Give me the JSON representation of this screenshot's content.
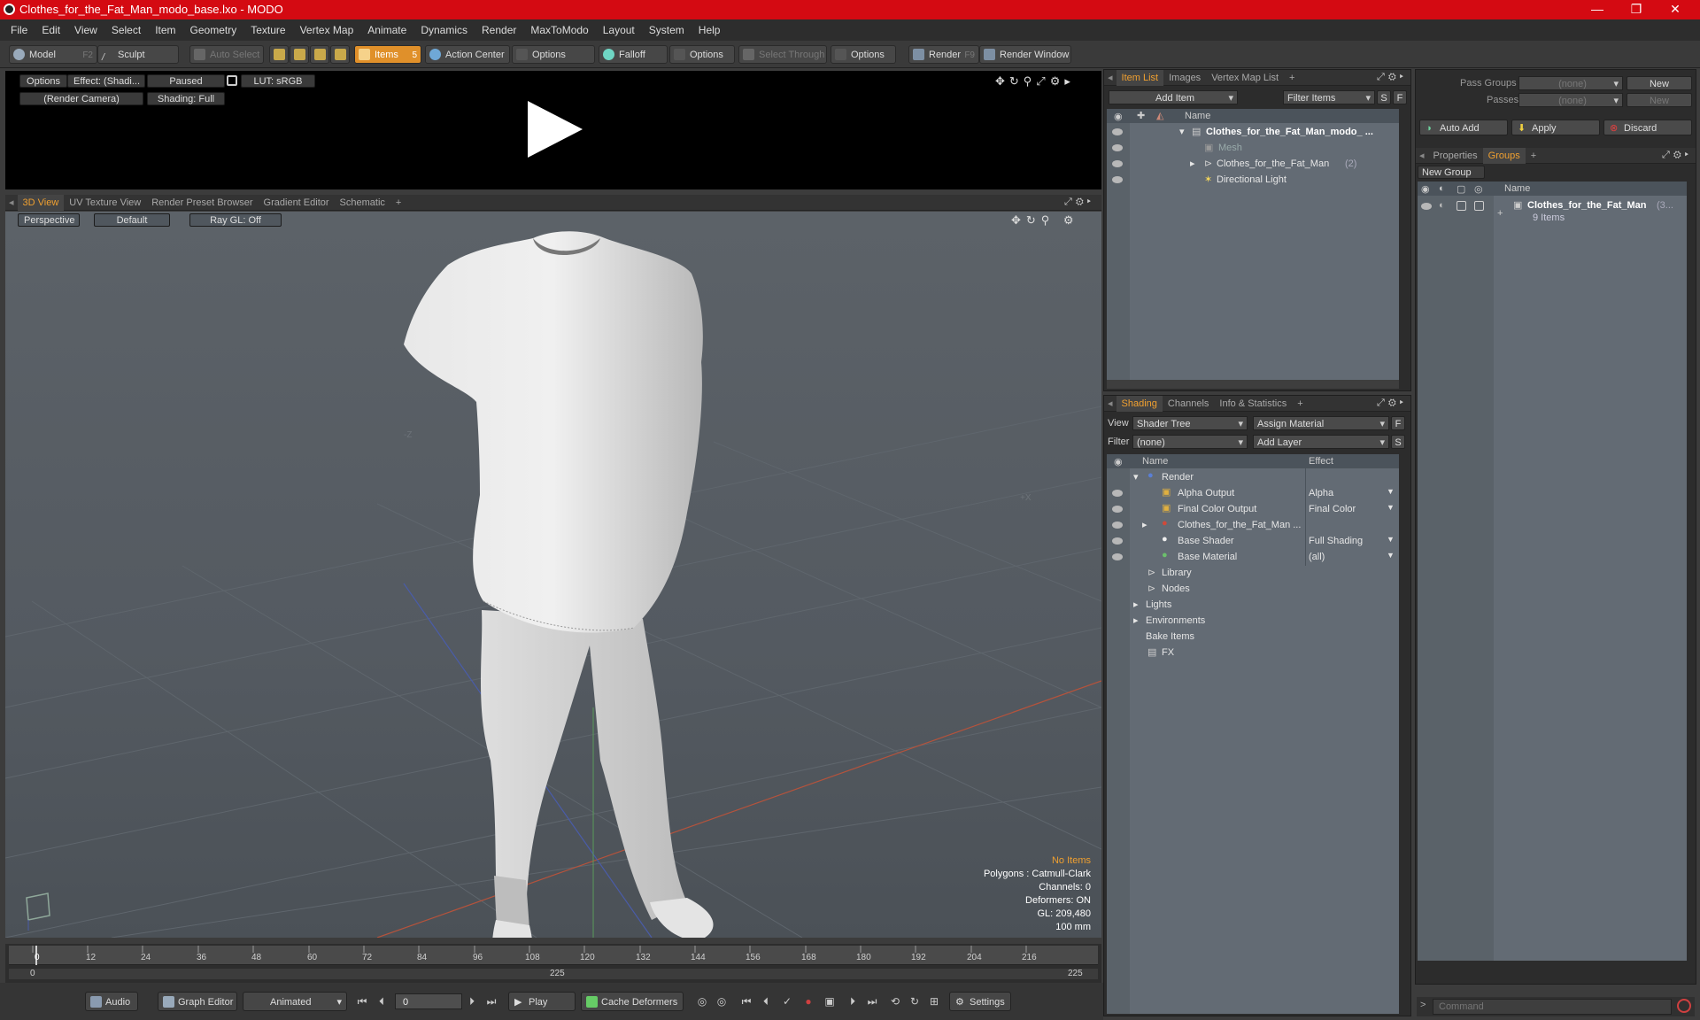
{
  "window": {
    "title": "Clothes_for_the_Fat_Man_modo_base.lxo - MODO",
    "min": "—",
    "max": "❐",
    "close": "✕"
  },
  "menu": [
    "File",
    "Edit",
    "View",
    "Select",
    "Item",
    "Geometry",
    "Texture",
    "Vertex Map",
    "Animate",
    "Dynamics",
    "Render",
    "MaxToModo",
    "Layout",
    "System",
    "Help"
  ],
  "toolbar": {
    "model": "Model",
    "model_key": "F2",
    "sculpt": "Sculpt",
    "auto_select": "Auto Select",
    "items": "Items",
    "items_key": "5",
    "action_center": "Action Center",
    "options1": "Options",
    "falloff": "Falloff",
    "options2": "Options",
    "select_through": "Select Through",
    "options3": "Options",
    "render": "Render",
    "render_key": "F9",
    "render_window": "Render Window"
  },
  "preview": {
    "options": "Options",
    "effect": "Effect: (Shadi...",
    "paused": "Paused",
    "lut": "LUT: sRGB",
    "camera": "(Render Camera)",
    "shading": "Shading: Full"
  },
  "viewtabs": [
    "3D View",
    "UV Texture View",
    "Render Preset Browser",
    "Gradient Editor",
    "Schematic",
    "+"
  ],
  "viewport": {
    "perspective": "Perspective",
    "default": "Default",
    "raygl": "Ray GL: Off",
    "axis_z": "-Z",
    "axis_x": "+X"
  },
  "stats": {
    "no_items": "No Items",
    "polygons": "Polygons : Catmull-Clark",
    "channels": "Channels: 0",
    "deformers": "Deformers: ON",
    "gl": "GL: 209,480",
    "size": "100 mm"
  },
  "timeline": {
    "ticks": [
      "0",
      "12",
      "24",
      "36",
      "48",
      "60",
      "72",
      "84",
      "96",
      "108",
      "120",
      "132",
      "144",
      "156",
      "168",
      "180",
      "192",
      "204",
      "216"
    ],
    "start": "0",
    "mid": "225",
    "end": "225"
  },
  "bottom": {
    "audio": "Audio",
    "graph_editor": "Graph Editor",
    "animated": "Animated",
    "frame": "0",
    "play": "Play",
    "cache": "Cache Deformers",
    "settings": "Settings"
  },
  "itemlist": {
    "tabs": [
      "Item List",
      "Images",
      "Vertex Map List",
      "+"
    ],
    "add_item": "Add Item",
    "filter": "Filter Items",
    "s": "S",
    "f": "F",
    "col_name": "Name",
    "rows": [
      {
        "label": "Clothes_for_the_Fat_Man_modo_ ..."
      },
      {
        "label": "Mesh"
      },
      {
        "label": "Clothes_for_the_Fat_Man",
        "count": "(2)"
      },
      {
        "label": "Directional Light"
      }
    ]
  },
  "shading": {
    "tabs": [
      "Shading",
      "Channels",
      "Info & Statistics",
      "+"
    ],
    "view_label": "View",
    "view_value": "Shader Tree",
    "assign": "Assign Material",
    "filter_label": "Filter",
    "filter_value": "(none)",
    "add_layer": "Add Layer",
    "f": "F",
    "s": "S",
    "col_name": "Name",
    "col_effect": "Effect",
    "rows": [
      {
        "name": "Render",
        "effect": ""
      },
      {
        "name": "Alpha Output",
        "effect": "Alpha"
      },
      {
        "name": "Final Color Output",
        "effect": "Final Color"
      },
      {
        "name": "Clothes_for_the_Fat_Man ...",
        "effect": ""
      },
      {
        "name": "Base Shader",
        "effect": "Full Shading"
      },
      {
        "name": "Base Material",
        "effect": "(all)"
      },
      {
        "name": "Library",
        "effect": ""
      },
      {
        "name": "Nodes",
        "effect": ""
      },
      {
        "name": "Lights",
        "effect": ""
      },
      {
        "name": "Environments",
        "effect": ""
      },
      {
        "name": "Bake Items",
        "effect": ""
      },
      {
        "name": "FX",
        "effect": ""
      }
    ]
  },
  "groups": {
    "pass_groups": "Pass Groups",
    "passes": "Passes",
    "none1": "(none)",
    "none2": "(none)",
    "new1": "New",
    "new2": "New",
    "auto_add": "Auto Add",
    "apply": "Apply",
    "discard": "Discard",
    "tabs": [
      "Properties",
      "Groups",
      "+"
    ],
    "new_group": "New Group",
    "col_name": "Name",
    "group_name": "Clothes_for_the_Fat_Man",
    "group_count": "(3...",
    "group_items": "9 Items"
  },
  "command": {
    "placeholder": "Command",
    "prompt": ">"
  }
}
